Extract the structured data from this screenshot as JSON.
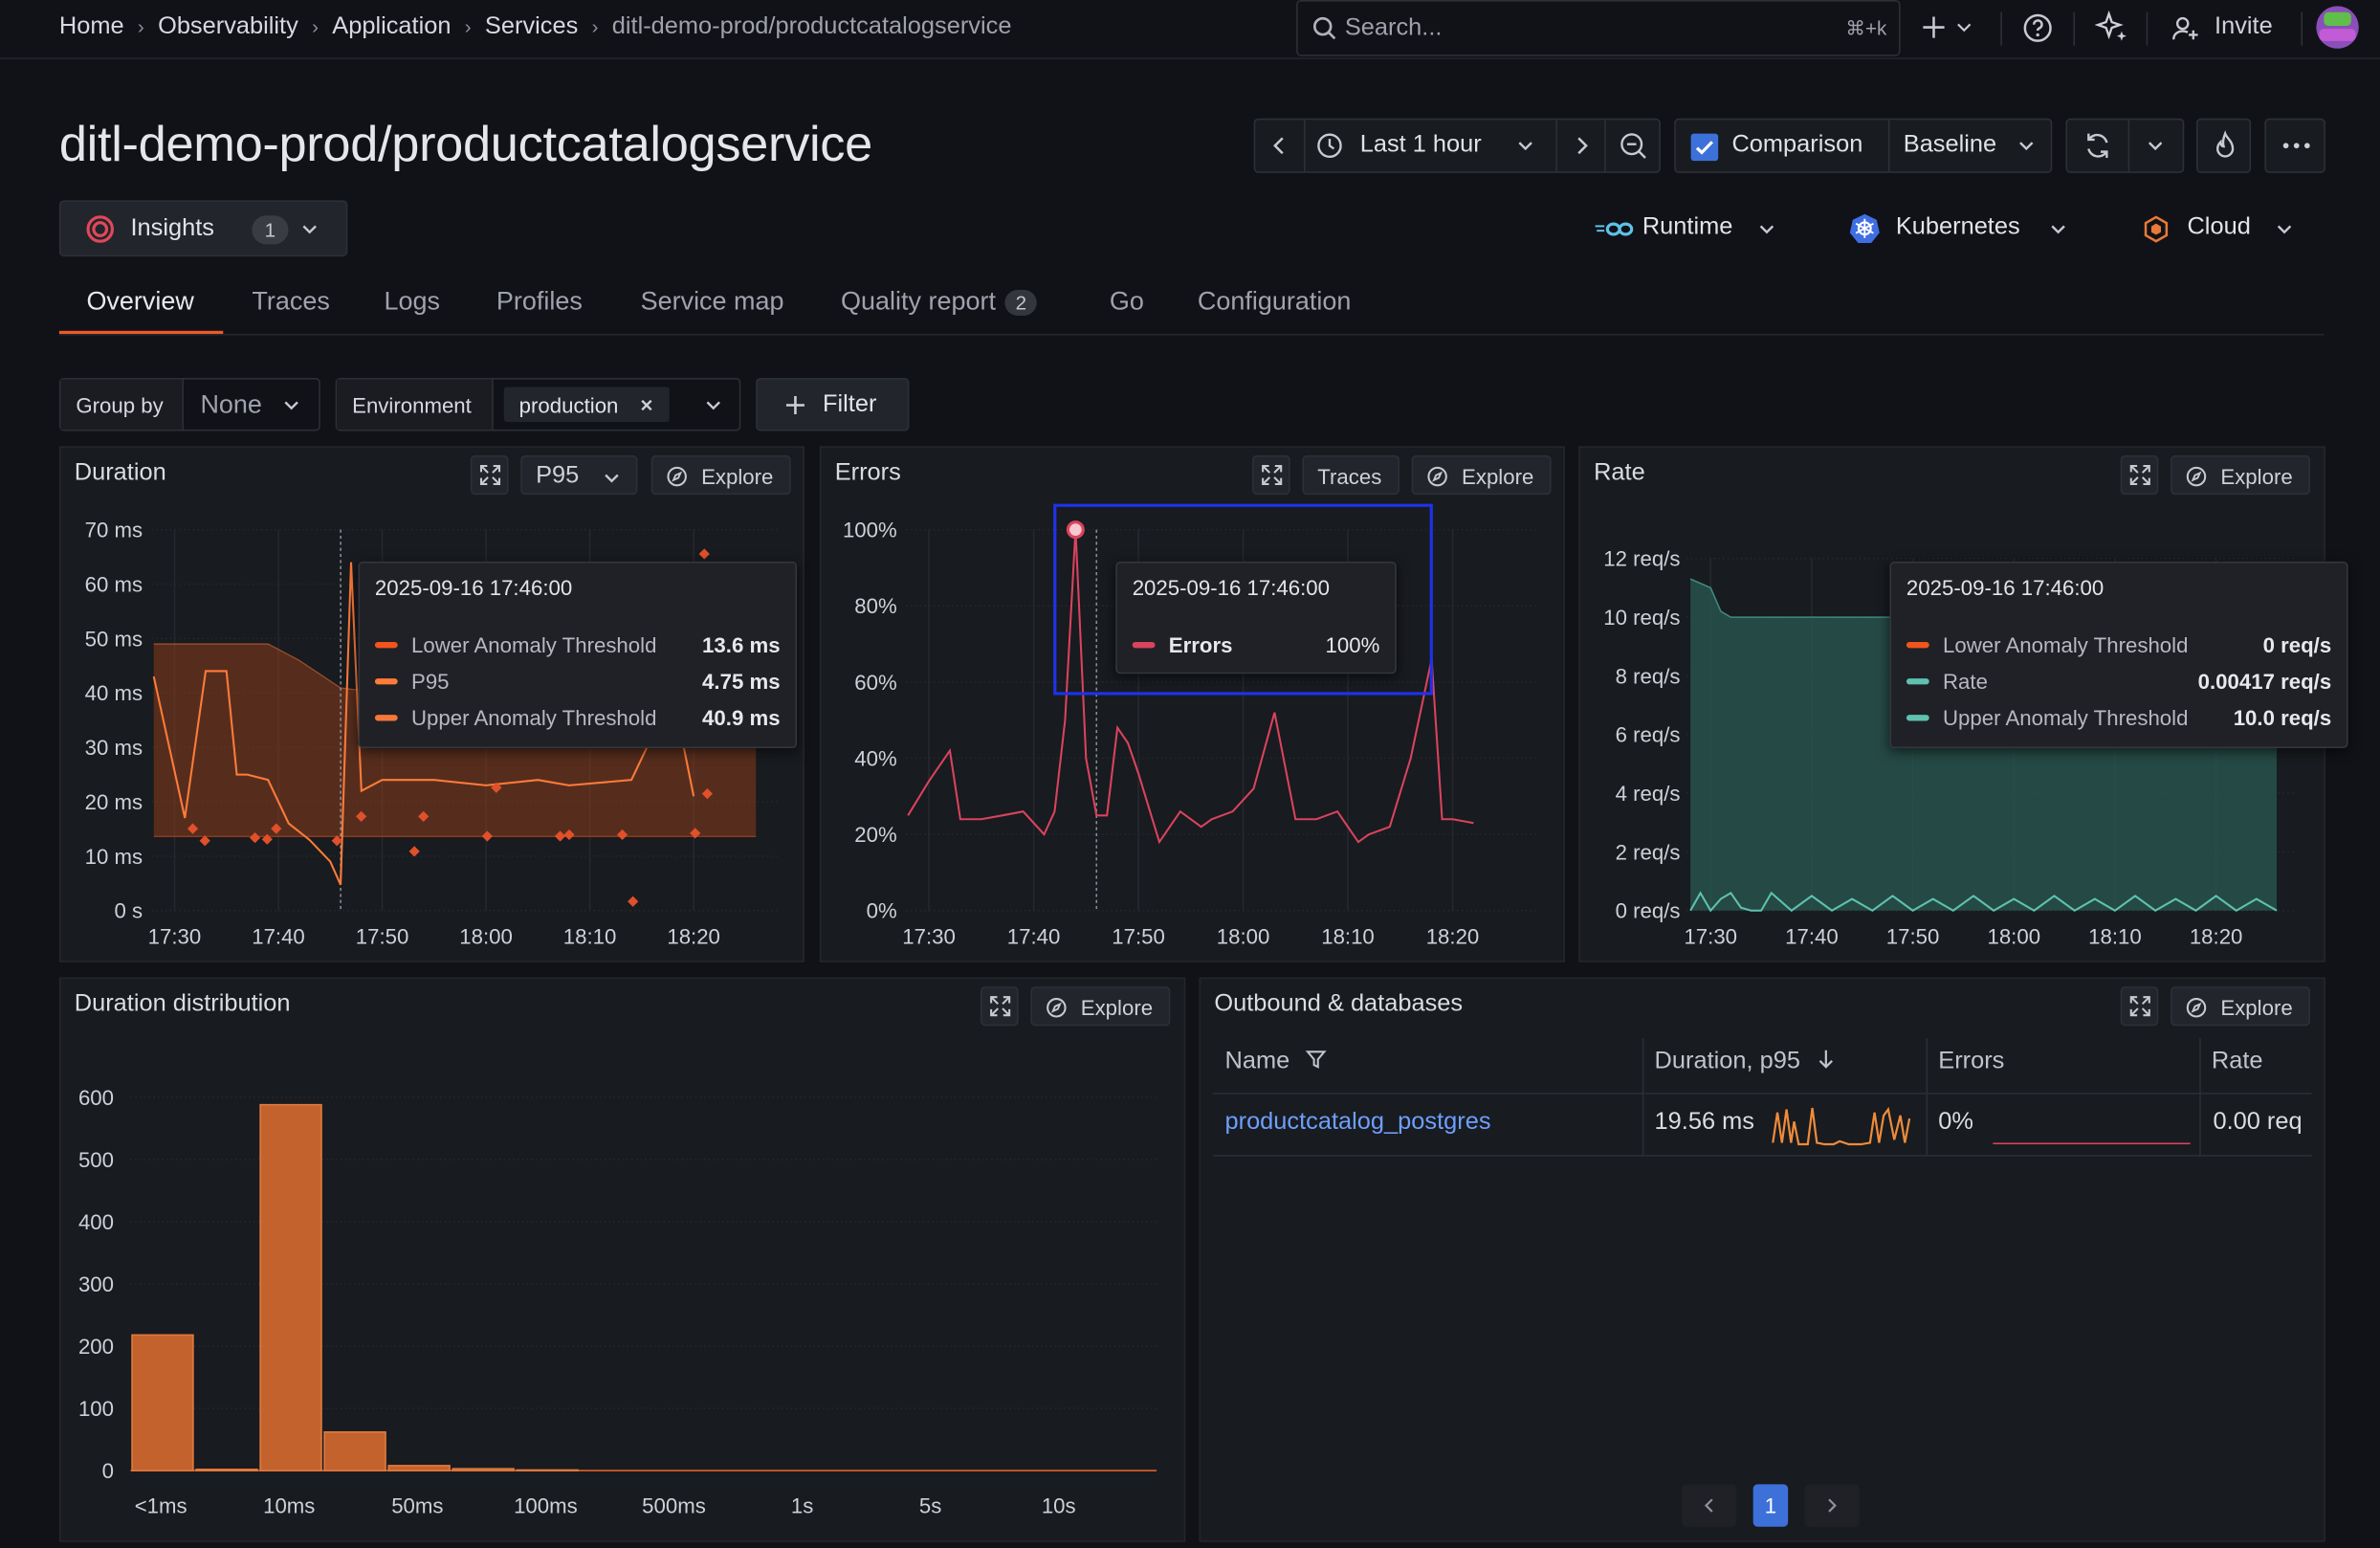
{
  "breadcrumbs": [
    "Home",
    "Observability",
    "Application",
    "Services",
    "ditl-demo-prod/productcatalogservice"
  ],
  "search": {
    "placeholder": "Search...",
    "shortcut": "⌘+k"
  },
  "header_actions": {
    "invite": "Invite"
  },
  "page_title": "ditl-demo-prod/productcatalogservice",
  "time_controls": {
    "range": "Last 1 hour",
    "comparison": "Comparison",
    "comparison_checked": true,
    "baseline": "Baseline"
  },
  "insights": {
    "label": "Insights",
    "count": "1"
  },
  "integrations": [
    "Runtime",
    "Kubernetes",
    "Cloud"
  ],
  "tabs": [
    {
      "label": "Overview",
      "active": true
    },
    {
      "label": "Traces"
    },
    {
      "label": "Logs"
    },
    {
      "label": "Profiles"
    },
    {
      "label": "Service map"
    },
    {
      "label": "Quality report",
      "badge": "2"
    },
    {
      "label": "Go"
    },
    {
      "label": "Configuration"
    }
  ],
  "filters": {
    "group_by_label": "Group by",
    "group_by_value": "None",
    "environment_label": "Environment",
    "environment_value": "production",
    "filter_button": "Filter"
  },
  "panels": {
    "duration": {
      "title": "Duration",
      "stat": "P95",
      "explore": "Explore"
    },
    "errors": {
      "title": "Errors",
      "traces": "Traces",
      "explore": "Explore"
    },
    "rate": {
      "title": "Rate",
      "explore": "Explore"
    },
    "distribution": {
      "title": "Duration distribution",
      "explore": "Explore"
    },
    "outbound": {
      "title": "Outbound & databases",
      "explore": "Explore"
    }
  },
  "tooltips": {
    "duration": {
      "time": "2025-09-16 17:46:00",
      "rows": [
        {
          "label": "Lower Anomaly Threshold",
          "value": "13.6 ms",
          "color": "#f2541e"
        },
        {
          "label": "P95",
          "value": "4.75 ms",
          "color": "#ff7b39"
        },
        {
          "label": "Upper Anomaly Threshold",
          "value": "40.9 ms",
          "color": "#f5773a"
        }
      ]
    },
    "errors": {
      "time": "2025-09-16 17:46:00",
      "rows": [
        {
          "label": "Errors",
          "value": "100%",
          "color": "#d9435e"
        }
      ]
    },
    "rate": {
      "time": "2025-09-16 17:46:00",
      "rows": [
        {
          "label": "Lower Anomaly Threshold",
          "value": "0 req/s",
          "color": "#f2541e"
        },
        {
          "label": "Rate",
          "value": "0.00417 req/s",
          "color": "#5fc1b0"
        },
        {
          "label": "Upper Anomaly Threshold",
          "value": "10.0 req/s",
          "color": "#5fc1b0"
        }
      ]
    }
  },
  "outbound_table": {
    "columns": [
      "Name",
      "Duration, p95",
      "Errors",
      "Rate"
    ],
    "rows": [
      {
        "name": "productcatalog_postgres",
        "duration": "19.56 ms",
        "errors": "0%",
        "rate": "0.00 req"
      }
    ],
    "page": "1"
  },
  "chart_data": [
    {
      "type": "line",
      "title": "Duration",
      "x_ticks": [
        "17:30",
        "17:40",
        "17:50",
        "18:00",
        "18:10",
        "18:20"
      ],
      "y_ticks": [
        "0 s",
        "10 ms",
        "20 ms",
        "30 ms",
        "40 ms",
        "50 ms",
        "60 ms",
        "70 ms"
      ],
      "ylim": [
        0,
        70
      ],
      "series": [
        {
          "name": "P95",
          "color": "#ff7b39",
          "x": [
            "17:28",
            "17:31",
            "17:33",
            "17:35",
            "17:36",
            "17:37",
            "17:39",
            "17:41",
            "17:43",
            "17:45",
            "17:46",
            "17:47",
            "17:48",
            "17:50",
            "17:55",
            "18:00",
            "18:05",
            "18:08",
            "18:14",
            "18:18",
            "18:20"
          ],
          "values": [
            43,
            17,
            44,
            44,
            25,
            25,
            24,
            16,
            13,
            9,
            4.75,
            64,
            22,
            24,
            24,
            23,
            24,
            23,
            24,
            40,
            21
          ]
        },
        {
          "name": "Upper Anomaly Threshold",
          "color": "#f5773a",
          "x": [
            "17:28",
            "17:30",
            "17:33",
            "17:36",
            "17:39",
            "17:42",
            "17:46",
            "17:50",
            "17:55",
            "18:00",
            "18:10",
            "18:20",
            "18:26"
          ],
          "values": [
            49,
            49,
            49,
            49,
            49,
            46,
            40.9,
            40,
            40,
            40,
            40,
            40,
            40
          ]
        },
        {
          "name": "Lower Anomaly Threshold",
          "color": "#f2541e",
          "x": [
            "17:28",
            "17:46",
            "18:26"
          ],
          "values": [
            13.6,
            13.6,
            13.6
          ]
        }
      ]
    },
    {
      "type": "line",
      "title": "Errors",
      "x_ticks": [
        "17:30",
        "17:40",
        "17:50",
        "18:00",
        "18:10",
        "18:20"
      ],
      "y_ticks": [
        "0%",
        "20%",
        "40%",
        "60%",
        "80%",
        "100%"
      ],
      "ylim": [
        0,
        100
      ],
      "series": [
        {
          "name": "Errors",
          "color": "#d9435e",
          "x": [
            "17:28",
            "17:30",
            "17:32",
            "17:33",
            "17:35",
            "17:37",
            "17:39",
            "17:41",
            "17:42",
            "17:43",
            "17:44",
            "17:45",
            "17:46",
            "17:47",
            "17:48",
            "17:49",
            "17:50",
            "17:52",
            "17:54",
            "17:56",
            "17:57",
            "17:59",
            "18:01",
            "18:03",
            "18:05",
            "18:07",
            "18:09",
            "18:10",
            "18:11",
            "18:12",
            "18:14",
            "18:16",
            "18:18",
            "18:19",
            "18:20",
            "18:22"
          ],
          "values": [
            25,
            34,
            42,
            24,
            24,
            25,
            26,
            20,
            26,
            50,
            100,
            40,
            25,
            25,
            48,
            44,
            36,
            18,
            26,
            22,
            24,
            26,
            32,
            52,
            24,
            24,
            26,
            22,
            18,
            20,
            22,
            40,
            66,
            24,
            24,
            23
          ]
        }
      ]
    },
    {
      "type": "area",
      "title": "Rate",
      "x_ticks": [
        "17:30",
        "17:40",
        "17:50",
        "18:00",
        "18:10",
        "18:20"
      ],
      "y_ticks": [
        "0 req/s",
        "2 req/s",
        "4 req/s",
        "6 req/s",
        "8 req/s",
        "10 req/s",
        "12 req/s"
      ],
      "ylim": [
        0,
        12
      ],
      "series": [
        {
          "name": "Upper Anomaly Threshold",
          "color": "#5fc1b0",
          "x": [
            "17:28",
            "17:30",
            "17:31",
            "17:32",
            "17:35",
            "17:45",
            "17:50",
            "18:00",
            "18:10",
            "18:20",
            "18:26"
          ],
          "values": [
            11.3,
            11.0,
            10.2,
            10.0,
            10.0,
            10.0,
            10.0,
            10.0,
            10.0,
            10.0,
            10.0
          ]
        },
        {
          "name": "Rate",
          "color": "#5fc1b0",
          "x": [
            "17:28",
            "17:29",
            "17:30",
            "17:31",
            "17:32",
            "17:33",
            "17:34",
            "17:35",
            "17:36",
            "17:38",
            "17:40",
            "17:42",
            "17:44",
            "17:46",
            "17:48",
            "17:50",
            "17:52",
            "17:54",
            "17:56",
            "17:58",
            "18:00",
            "18:02",
            "18:04",
            "18:06",
            "18:08",
            "18:10",
            "18:12",
            "18:14",
            "18:16",
            "18:18",
            "18:20",
            "18:22",
            "18:24",
            "18:26"
          ],
          "values": [
            0,
            0.6,
            0,
            0.4,
            0.6,
            0.1,
            0,
            0,
            0.6,
            0,
            0.5,
            0,
            0.4,
            0,
            0.5,
            0,
            0.4,
            0,
            0.5,
            0,
            0.4,
            0,
            0.5,
            0,
            0.4,
            0,
            0.5,
            0,
            0.4,
            0,
            0.5,
            0,
            0.4,
            0
          ]
        },
        {
          "name": "Lower Anomaly Threshold",
          "color": "#f2541e",
          "x": [
            "17:28",
            "18:26"
          ],
          "values": [
            0,
            0
          ]
        }
      ]
    },
    {
      "type": "bar",
      "title": "Duration distribution",
      "x_ticks": [
        "<1ms",
        "10ms",
        "50ms",
        "100ms",
        "500ms",
        "1s",
        "5s",
        "10s"
      ],
      "y_ticks": [
        "0",
        "100",
        "200",
        "300",
        "400",
        "500",
        "600"
      ],
      "ylim": [
        0,
        600
      ],
      "values": [
        218,
        2,
        588,
        62,
        8,
        3,
        1,
        0,
        0,
        0,
        0,
        0,
        0,
        0,
        0,
        0
      ]
    }
  ]
}
